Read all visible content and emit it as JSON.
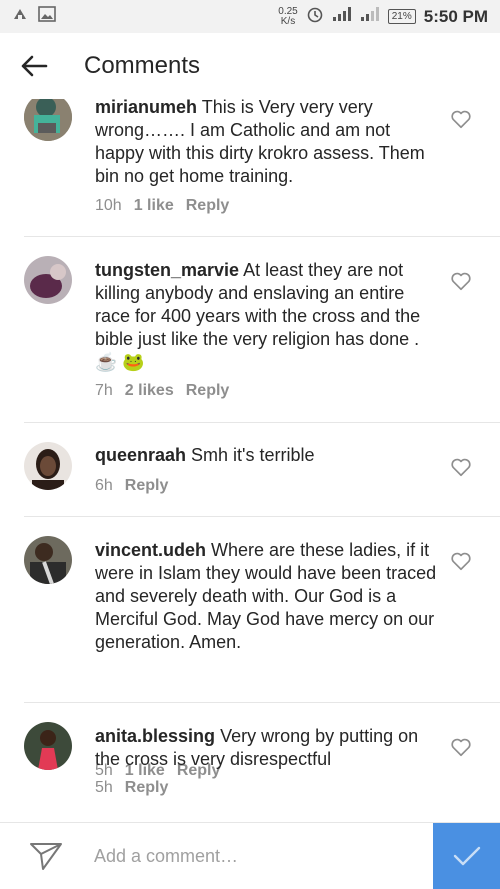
{
  "status_bar": {
    "speed_value": "0.25",
    "speed_unit": "K/s",
    "battery": "21%",
    "time": "5:50 PM",
    "icons": [
      "notification-icon",
      "image-icon",
      "alarm-icon",
      "signal-icon",
      "data-signal-icon",
      "battery-icon"
    ]
  },
  "header": {
    "title": "Comments",
    "back_icon": "arrow-left-icon"
  },
  "comments": [
    {
      "username": "mirianumeh",
      "text": "This is Very very very wrong……. I am Catholic and am not happy with this dirty krokro assess. Them bin no get home training.",
      "time": "10h",
      "likes": "1 like",
      "reply": "Reply"
    },
    {
      "username": "tungsten_marvie",
      "text": "At least they are not killing anybody and enslaving  an entire race  for 400 years with the cross and the bible just like the very religion has done . ☕ 🐸",
      "time": "7h",
      "likes": "2 likes",
      "reply": "Reply"
    },
    {
      "username": "queenraah",
      "text": "Smh  it's terrible",
      "time": "6h",
      "likes": "",
      "reply": "Reply"
    },
    {
      "username": "vincent.udeh",
      "text": "Where are these ladies, if it were in Islam they would have been traced and severely death with. Our God is a Merciful God. May God have mercy on our generation. Amen.",
      "time": "5h",
      "likes": "1 like",
      "reply": "Reply"
    },
    {
      "username": "anita.blessing",
      "text": "Very wrong by putting on the cross is very disrespectful",
      "time": "5h",
      "likes": "",
      "reply": "Reply"
    }
  ],
  "composer": {
    "placeholder": "Add a comment…",
    "value": ""
  },
  "colors": {
    "accent": "#4a90e2",
    "meta_text": "#8e8e8e",
    "divider": "#e6e6e6"
  }
}
